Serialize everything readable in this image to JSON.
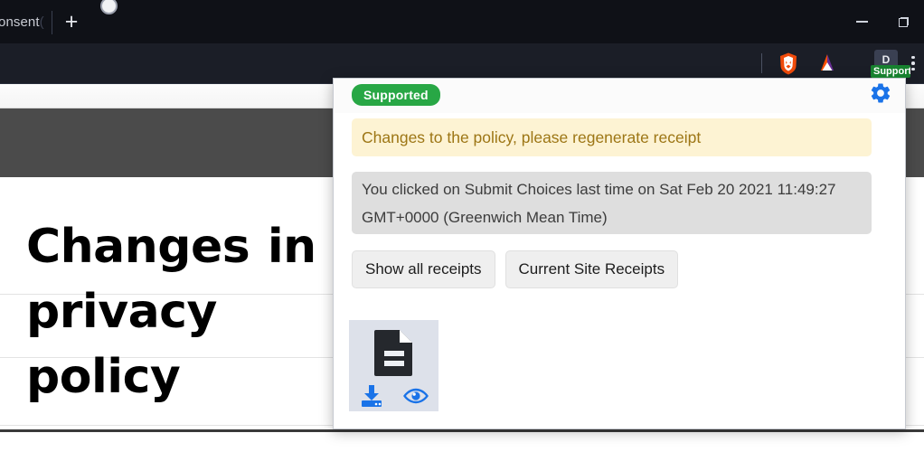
{
  "browser": {
    "tab": {
      "title": "onsent",
      "title_faded": "(",
      "newtab_label": "+"
    },
    "window_controls": {
      "minimize": "minimize-icon",
      "maximize": "restore-icon"
    },
    "toolbar": {
      "brave_icon": "brave-lion-icon",
      "bat_icon": "bat-triangle-icon",
      "extension_letter": "D",
      "extension_badge": "Supported",
      "menu": "three-dot-menu-icon"
    }
  },
  "page": {
    "heading": "Changes in privacy policy"
  },
  "popup": {
    "status_badge": "Supported",
    "settings_icon": "gear-icon",
    "warning": "Changes to the policy, please regenerate receipt",
    "info": "You clicked on Submit Choices last time on Sat Feb 20 2021 11:49:27 GMT+0000 (Greenwich Mean Time)",
    "buttons": [
      {
        "label": "Show all receipts"
      },
      {
        "label": "Current Site Receipts"
      }
    ],
    "receipt_card": {
      "doc_icon": "document-icon",
      "download_icon": "download-icon",
      "view_icon": "eye-icon"
    }
  },
  "colors": {
    "chrome_dark": "#0f1117",
    "toolbar_dark": "#1b1e27",
    "green_badge": "#28a745",
    "warning_bg": "#fdf3d3",
    "warning_text": "#9d7615",
    "info_bg": "#dedede",
    "accent_blue": "#1a73e8",
    "page_darkbar": "#4b4b4b"
  }
}
